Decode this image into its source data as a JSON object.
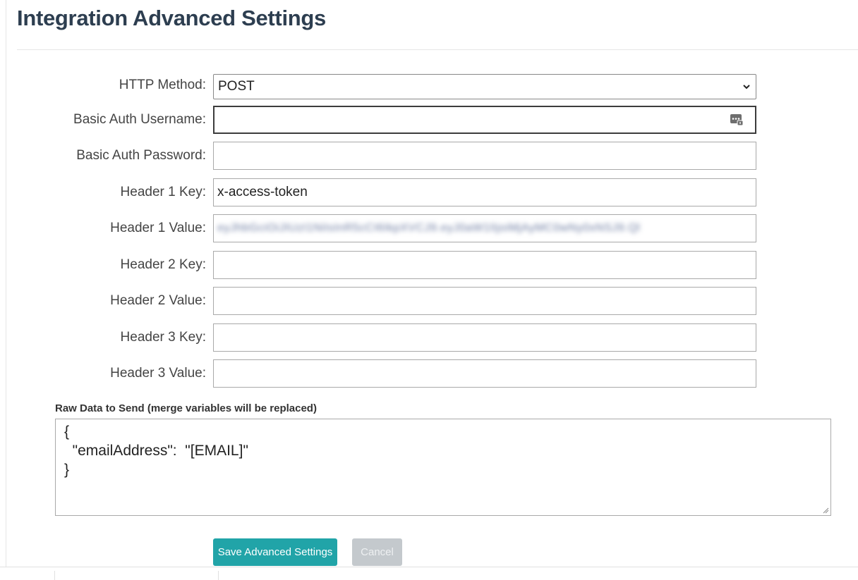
{
  "page": {
    "title": "Integration Advanced Settings"
  },
  "form": {
    "http_method": {
      "label": "HTTP Method:",
      "value": "POST",
      "options": [
        "POST"
      ]
    },
    "basic_auth_username": {
      "label": "Basic Auth Username:",
      "value": ""
    },
    "basic_auth_password": {
      "label": "Basic Auth Password:",
      "value": ""
    },
    "header1_key": {
      "label": "Header 1 Key:",
      "value": "x-access-token"
    },
    "header1_value": {
      "label": "Header 1 Value:",
      "value": "eyJhbGciOiJIUzI1NiIsInR5cCI6IkpXVCJ9.eyJ0aW1lIjoiMjAyMC0wNy0xNSJ9.Ql"
    },
    "header2_key": {
      "label": "Header 2 Key:",
      "value": ""
    },
    "header2_value": {
      "label": "Header 2 Value:",
      "value": ""
    },
    "header3_key": {
      "label": "Header 3 Key:",
      "value": ""
    },
    "header3_value": {
      "label": "Header 3 Value:",
      "value": ""
    },
    "raw_data": {
      "label": "Raw Data to Send (merge variables will be replaced)",
      "value": "{\n  \"emailAddress\":  \"[EMAIL]\"\n}"
    }
  },
  "buttons": {
    "save_label": "Save Advanced Settings",
    "cancel_label": "Cancel"
  },
  "colors": {
    "title": "#2d3e50",
    "accent": "#21a4a8",
    "disabled": "#c4c9cd"
  },
  "icons": {
    "select_arrow": "chevron-down-icon",
    "password_manager": "password-manager-key-icon"
  }
}
